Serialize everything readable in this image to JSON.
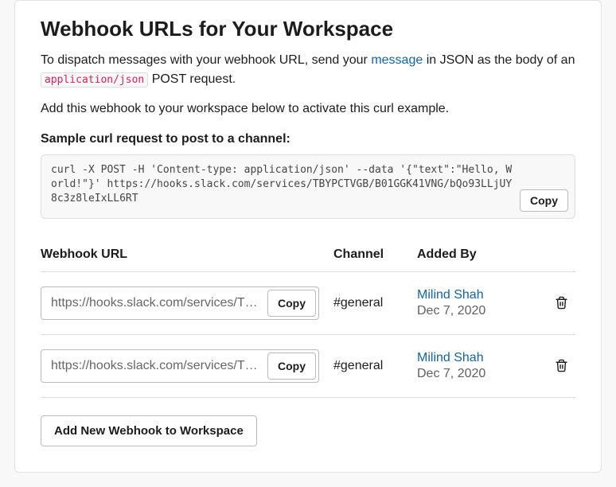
{
  "heading": "Webhook URLs for Your Workspace",
  "intro_part1": "To dispatch messages with your webhook URL, send your ",
  "intro_link": "message",
  "intro_part2": " in JSON as the body of an ",
  "intro_code": "application/json",
  "intro_part3": " POST request.",
  "intro_line2": "Add this webhook to your workspace below to activate this curl example.",
  "sample_label": "Sample curl request to post to a channel:",
  "sample_code": "curl -X POST -H 'Content-type: application/json' --data '{\"text\":\"Hello, World!\"}' https://hooks.slack.com/services/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",
  "copy_label": "Copy",
  "table": {
    "headers": {
      "url": "Webhook URL",
      "channel": "Channel",
      "addedby": "Added By"
    },
    "rows": [
      {
        "url": "https://hooks.slack.com/services/TBYPC",
        "channel": "#general",
        "name": "Milind Shah",
        "date": "Dec 7, 2020"
      },
      {
        "url": "https://hooks.slack.com/services/TBYPC",
        "channel": "#general",
        "name": "Milind Shah",
        "date": "Dec 7, 2020"
      }
    ]
  },
  "add_button": "Add New Webhook to Workspace"
}
